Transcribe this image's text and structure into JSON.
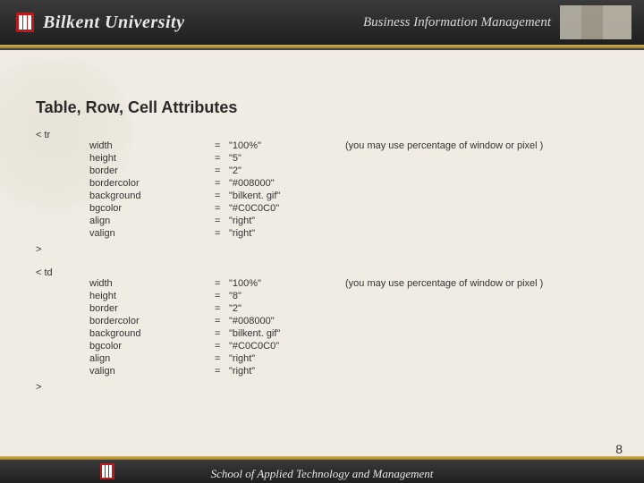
{
  "header": {
    "university": "Bilkent University",
    "program": "Business Information Management"
  },
  "footer": {
    "school": "School of Applied Technology and Management"
  },
  "slide": {
    "title": "Table, Row, Cell Attributes",
    "page_number": "8",
    "tr": {
      "open": "< tr",
      "close": ">",
      "note": "(you may use percentage of window or pixel )",
      "attrs": [
        {
          "name": "width",
          "eq": "=",
          "val": "\"100%\""
        },
        {
          "name": "height",
          "eq": "=",
          "val": "\"5\""
        },
        {
          "name": "border",
          "eq": "=",
          "val": "\"2\""
        },
        {
          "name": "bordercolor",
          "eq": "=",
          "val": "\"#008000\""
        },
        {
          "name": "background",
          "eq": "=",
          "val": "\"bilkent. gif\""
        },
        {
          "name": "bgcolor",
          "eq": "=",
          "val": "\"#C0C0C0\""
        },
        {
          "name": "align",
          "eq": "=",
          "val": "\"right\""
        },
        {
          "name": "valign",
          "eq": "=",
          "val": "\"right\""
        }
      ]
    },
    "td": {
      "open": "< td",
      "close": ">",
      "note": "(you may use percentage of window or pixel )",
      "attrs": [
        {
          "name": "width",
          "eq": "=",
          "val": "\"100%\""
        },
        {
          "name": "height",
          "eq": "=",
          "val": "\"8\""
        },
        {
          "name": "border",
          "eq": "=",
          "val": "\"2\""
        },
        {
          "name": "bordercolor",
          "eq": "=",
          "val": "\"#008000\""
        },
        {
          "name": "background",
          "eq": "=",
          "val": "\"bilkent. gif\""
        },
        {
          "name": "bgcolor",
          "eq": "=",
          "val": "\"#C0C0C0\""
        },
        {
          "name": "align",
          "eq": "=",
          "val": "\"right\""
        },
        {
          "name": "valign",
          "eq": "=",
          "val": "\"right\""
        }
      ]
    }
  }
}
